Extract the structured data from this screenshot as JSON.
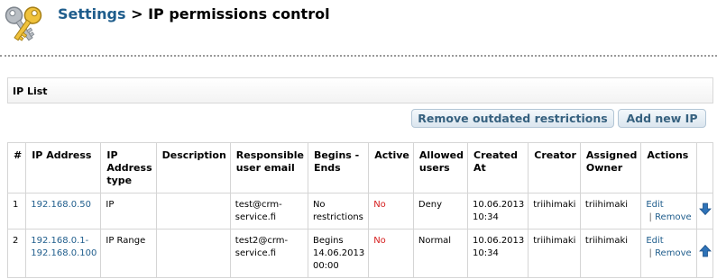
{
  "header": {
    "breadcrumb_link": "Settings",
    "separator": " > ",
    "title": "IP permissions control"
  },
  "section": {
    "title": "IP List"
  },
  "toolbar": {
    "remove_outdated_label": "Remove outdated restrictions",
    "add_new_label": "Add new IP"
  },
  "table": {
    "headers": {
      "num": "#",
      "ip_address": "IP Address",
      "ip_type": "IP Address type",
      "description": "Description",
      "email": "Responsible user email",
      "begins_ends": "Begins - Ends",
      "active": "Active",
      "allowed_users": "Allowed users",
      "created_at": "Created At",
      "creator": "Creator",
      "owner": "Assigned Owner",
      "actions": "Actions"
    },
    "rows": [
      {
        "num": "1",
        "ip": "192.168.0.50",
        "type": "IP",
        "description": "",
        "email": "test@crm-service.fi",
        "begins_ends": "No restrictions",
        "active": "No",
        "allowed": "Deny",
        "created": "10.06.2013 10:34",
        "creator": "triihimaki",
        "owner": "triihimaki",
        "edit_label": "Edit",
        "action_sep": " | ",
        "remove_label": "Remove",
        "move_icon": "arrow-down-icon"
      },
      {
        "num": "2",
        "ip": "192.168.0.1-192.168.0.100",
        "type": "IP Range",
        "description": "",
        "email": "test2@crm-service.fi",
        "begins_ends": "Begins 14.06.2013 00:00",
        "active": "No",
        "allowed": "Normal",
        "created": "10.06.2013 10:34",
        "creator": "triihimaki",
        "owner": "triihimaki",
        "edit_label": "Edit",
        "action_sep": " | ",
        "remove_label": "Remove",
        "move_icon": "arrow-up-icon"
      }
    ]
  },
  "colors": {
    "link": "#1f5d8c",
    "inactive": "#d62020",
    "arrow": "#2f73b8",
    "button_text": "#36617f"
  },
  "icons": {
    "header": "keys-icon"
  }
}
